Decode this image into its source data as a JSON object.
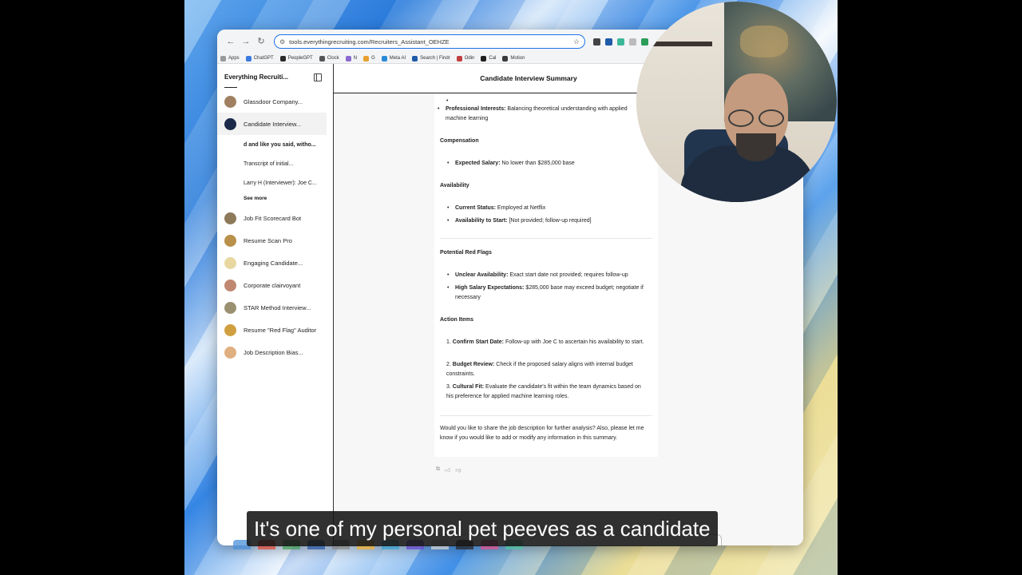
{
  "browser": {
    "url": "tools.everythingrecruiting.com/Recruiters_Assistant_OEHZE",
    "bookmarks": [
      "Apps",
      "ChatGPT",
      "PeopleGPT",
      "Clock",
      "N",
      "G",
      "Meta AI",
      "Search | Findr",
      "Odin",
      "Cal",
      "Motion"
    ],
    "colors": {
      "accent": "#1a73e8"
    }
  },
  "sidebar": {
    "title": "Everything Recruiti...",
    "items": [
      {
        "label": "Glassdoor Company...",
        "color": "#a08060"
      },
      {
        "label": "Candidate Interview...",
        "color": "#1c2a4a",
        "active": true
      }
    ],
    "subitems": [
      "d and like you said, witho...",
      "Transcript of initial...",
      "Larry H (Interviewer): Joe C..."
    ],
    "see_more": "See more",
    "items_after": [
      {
        "label": "Job Fit Scorecard Bot",
        "color": "#8c7a5a"
      },
      {
        "label": "Resume Scan Pro",
        "color": "#b8904a"
      },
      {
        "label": "Engaging Candidate...",
        "color": "#e8d8a0"
      },
      {
        "label": "Corporate clairvoyant",
        "color": "#c08870"
      },
      {
        "label": "STAR Method Interview...",
        "color": "#9a9070"
      },
      {
        "label": "Resume \"Red Flag\" Auditor",
        "color": "#d0a040"
      },
      {
        "label": "Job Description Bias...",
        "color": "#e0b080"
      }
    ]
  },
  "main": {
    "title": "Candidate Interview Summary",
    "professional_interests_label": "Professional Interests:",
    "professional_interests_text": "Balancing theoretical understanding with applied machine learning",
    "compensation_title": "Compensation",
    "expected_salary_label": "Expected Salary:",
    "expected_salary_text": "No lower than $285,000 base",
    "availability_title": "Availability",
    "current_status_label": "Current Status:",
    "current_status_text": "Employed at Netflix",
    "availability_start_label": "Availability to Start:",
    "availability_start_text": "[Not provided; follow-up required]",
    "red_flags_title": "Potential Red Flags",
    "unclear_label": "Unclear Availability:",
    "unclear_text": "Exact start date not provided; requires follow-up",
    "salary_exp_label": "High Salary Expectations:",
    "salary_exp_text": "$285,000 base may exceed budget; negotiate if necessary",
    "action_title": "Action Items",
    "action_items": [
      {
        "num": "1.",
        "label": "Confirm Start Date:",
        "text": "Follow-up with Joe C to ascertain his availability to start."
      },
      {
        "num": "2.",
        "label": "Budget Review:",
        "text": "Check if the proposed salary aligns with internal budget constraints."
      },
      {
        "num": "3.",
        "label": "Cultural Fit:",
        "text": "Evaluate the candidate's fit within the team dynamics based on his preference for applied machine learning roles."
      }
    ],
    "closing": "Would you like to share the job description for further analysis? Also, please let me know if you would like to add or modify any information in this summary."
  },
  "caption": "It's one of my personal pet peeves as a candidate"
}
